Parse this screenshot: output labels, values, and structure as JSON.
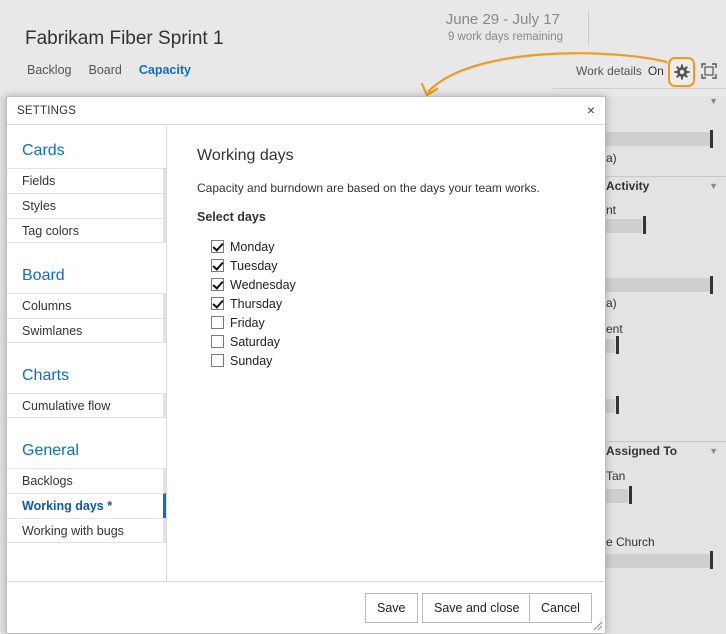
{
  "page": {
    "title": "Fabrikam Fiber Sprint 1",
    "dates": "June 29 - July 17",
    "remaining": "9 work days remaining",
    "tabs": [
      "Backlog",
      "Board",
      "Capacity"
    ],
    "work_details_label": "Work details",
    "work_details_state": "On"
  },
  "right_panel": {
    "text_1": "a)",
    "head_activity": "Activity",
    "text_2": "nt",
    "text_3": "a)",
    "text_4": "ent",
    "head_assigned": "Assigned To",
    "text_5": "Tan",
    "text_6": "e Church"
  },
  "dialog": {
    "title": "SETTINGS",
    "close": "×",
    "nav": {
      "cards": {
        "label": "Cards",
        "items": [
          "Fields",
          "Styles",
          "Tag colors"
        ]
      },
      "board": {
        "label": "Board",
        "items": [
          "Columns",
          "Swimlanes"
        ]
      },
      "charts": {
        "label": "Charts",
        "items": [
          "Cumulative flow"
        ]
      },
      "general": {
        "label": "General",
        "items": [
          "Backlogs",
          "Working days *",
          "Working with bugs"
        ]
      }
    },
    "content": {
      "heading": "Working days",
      "description": "Capacity and burndown are based on the days your team works.",
      "select_label": "Select days",
      "days": [
        {
          "label": "Monday",
          "checked": true
        },
        {
          "label": "Tuesday",
          "checked": true
        },
        {
          "label": "Wednesday",
          "checked": true
        },
        {
          "label": "Thursday",
          "checked": true
        },
        {
          "label": "Friday",
          "checked": false
        },
        {
          "label": "Saturday",
          "checked": false
        },
        {
          "label": "Sunday",
          "checked": false
        }
      ]
    },
    "buttons": {
      "save": "Save",
      "save_close": "Save and close",
      "cancel": "Cancel"
    }
  },
  "colors": {
    "accent": "#106ebe",
    "highlight": "#f39a1e"
  }
}
